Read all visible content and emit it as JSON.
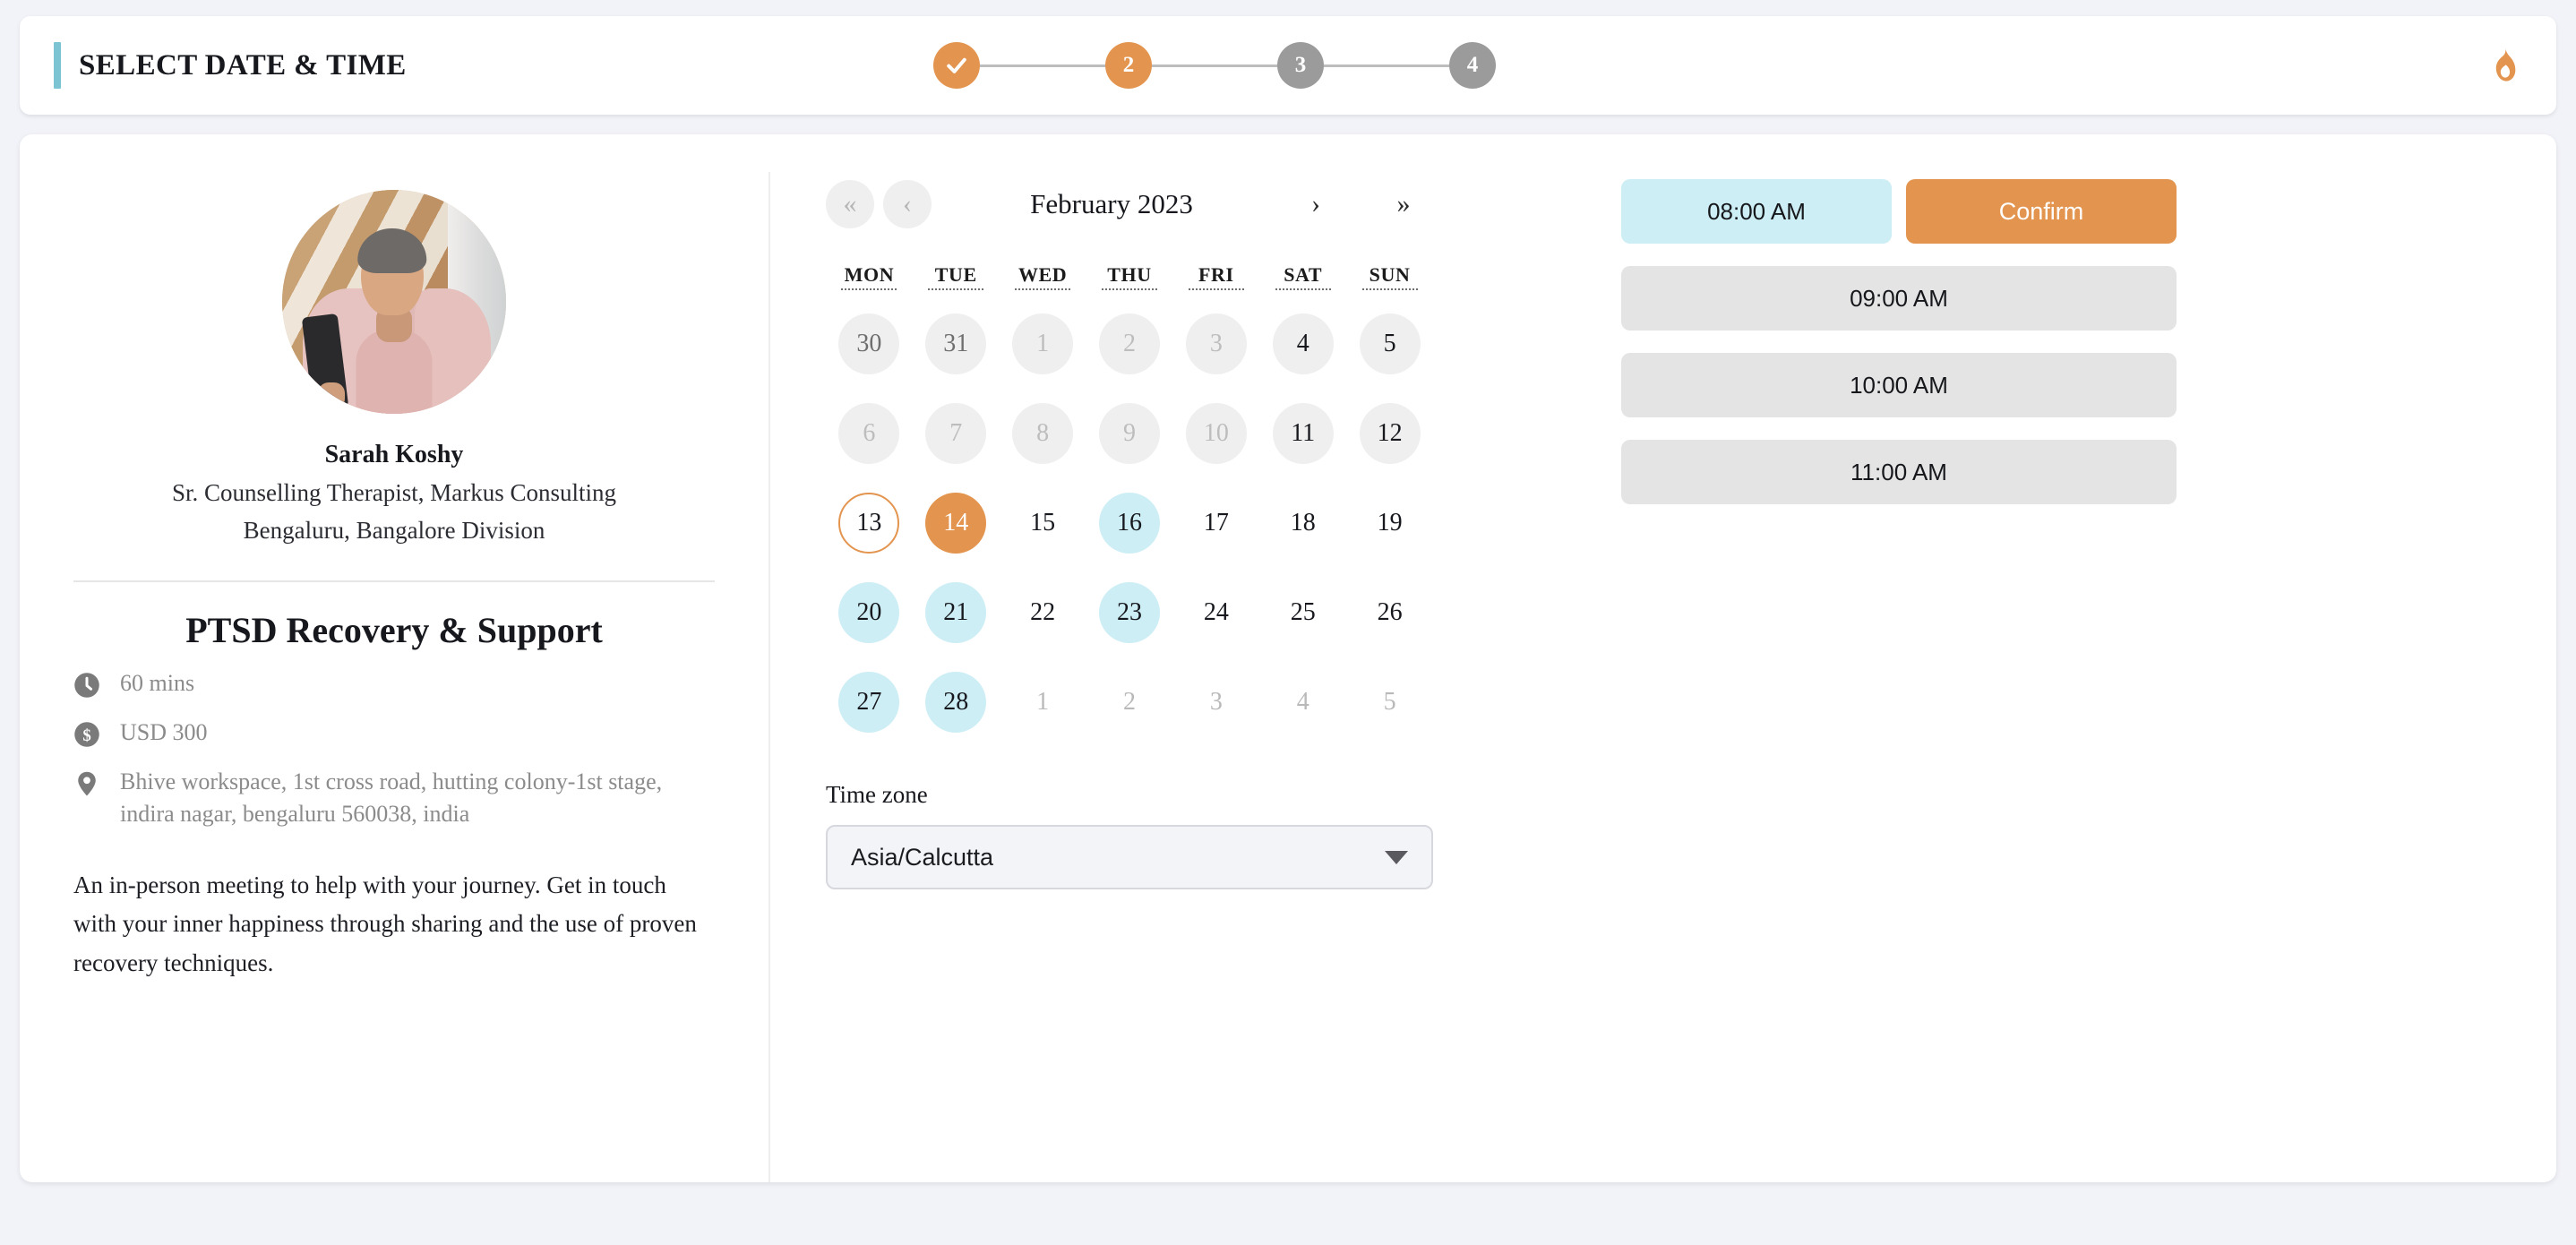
{
  "header": {
    "title": "SELECT DATE & TIME",
    "accent_color": "#7cc4d4",
    "brand_icon": "flame-icon",
    "brand_color": "#e3954f"
  },
  "stepper": {
    "active_color": "#e3954f",
    "idle_color": "#9b9b9b",
    "steps": [
      {
        "label": "✓",
        "state": "done"
      },
      {
        "label": "2",
        "state": "active"
      },
      {
        "label": "3",
        "state": "idle"
      },
      {
        "label": "4",
        "state": "idle"
      }
    ]
  },
  "profile": {
    "avatar_alt": "Sarah Koshy portrait",
    "name": "Sarah Koshy",
    "role": "Sr. Counselling Therapist, Markus Consulting",
    "location": "Bengaluru, Bangalore Division",
    "service_title": "PTSD Recovery & Support",
    "meta": [
      {
        "icon": "clock-icon",
        "text": "60 mins"
      },
      {
        "icon": "dollar-icon",
        "text": "USD 300"
      },
      {
        "icon": "location-pin-icon",
        "text": "Bhive workspace, 1st cross road, hutting colony-1st stage, indira nagar, bengaluru 560038, india"
      }
    ],
    "description": "An in-person meeting to help with your journey. Get in touch with your inner happiness through sharing and the use of proven recovery techniques."
  },
  "calendar": {
    "month_label": "February 2023",
    "nav": {
      "prev_year": "«",
      "prev_month": "‹",
      "next_month": "›",
      "next_year": "»"
    },
    "weekdays": [
      "MON",
      "TUE",
      "WED",
      "THU",
      "FRI",
      "SAT",
      "SUN"
    ],
    "selected_color": "#e3954f",
    "available_color": "#cdeef5",
    "days": [
      {
        "n": "30",
        "state": "grayfill dimtext"
      },
      {
        "n": "31",
        "state": "grayfill dimtext"
      },
      {
        "n": "1",
        "state": "grayfill muted"
      },
      {
        "n": "2",
        "state": "grayfill muted"
      },
      {
        "n": "3",
        "state": "grayfill muted"
      },
      {
        "n": "4",
        "state": "grayfill"
      },
      {
        "n": "5",
        "state": "grayfill"
      },
      {
        "n": "6",
        "state": "grayfill muted"
      },
      {
        "n": "7",
        "state": "grayfill muted"
      },
      {
        "n": "8",
        "state": "grayfill muted"
      },
      {
        "n": "9",
        "state": "grayfill muted"
      },
      {
        "n": "10",
        "state": "grayfill muted"
      },
      {
        "n": "11",
        "state": "grayfill"
      },
      {
        "n": "12",
        "state": "grayfill"
      },
      {
        "n": "13",
        "state": "today"
      },
      {
        "n": "14",
        "state": "selected"
      },
      {
        "n": "15",
        "state": "plain"
      },
      {
        "n": "16",
        "state": "avail"
      },
      {
        "n": "17",
        "state": "plain"
      },
      {
        "n": "18",
        "state": "plain"
      },
      {
        "n": "19",
        "state": "plain"
      },
      {
        "n": "20",
        "state": "avail"
      },
      {
        "n": "21",
        "state": "avail"
      },
      {
        "n": "22",
        "state": "plain"
      },
      {
        "n": "23",
        "state": "avail"
      },
      {
        "n": "24",
        "state": "plain"
      },
      {
        "n": "25",
        "state": "plain"
      },
      {
        "n": "26",
        "state": "plain"
      },
      {
        "n": "27",
        "state": "avail"
      },
      {
        "n": "28",
        "state": "avail"
      },
      {
        "n": "1",
        "state": "nextmonth"
      },
      {
        "n": "2",
        "state": "nextmonth"
      },
      {
        "n": "3",
        "state": "nextmonth"
      },
      {
        "n": "4",
        "state": "nextmonth"
      },
      {
        "n": "5",
        "state": "nextmonth"
      }
    ]
  },
  "timezone": {
    "label": "Time zone",
    "value": "Asia/Calcutta"
  },
  "slots": {
    "confirm_label": "Confirm",
    "items": [
      {
        "label": "08:00 AM",
        "state": "selected"
      },
      {
        "label": "09:00 AM",
        "state": "normal"
      },
      {
        "label": "10:00 AM",
        "state": "normal"
      },
      {
        "label": "11:00 AM",
        "state": "normal"
      }
    ]
  }
}
